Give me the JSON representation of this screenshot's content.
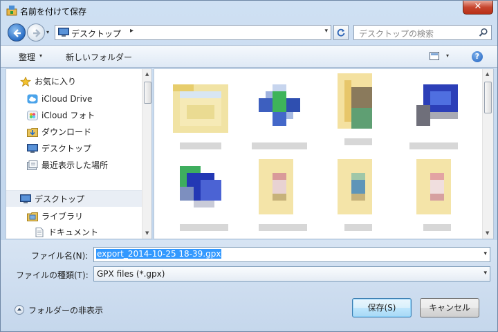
{
  "window": {
    "title": "名前を付けて保存",
    "close_glyph": "✕"
  },
  "address": {
    "location": "デスクトップ",
    "chevron": "▸",
    "dropdown": "▾"
  },
  "search": {
    "placeholder": "デスクトップの検索"
  },
  "toolbar": {
    "organize": "整理",
    "organize_arrow": "▾",
    "new_folder": "新しいフォルダー",
    "view_arrow": "▾",
    "help": "?"
  },
  "navpane": {
    "favorites": [
      {
        "label": "お気に入り",
        "icon": "star-icon"
      },
      {
        "label": "iCloud Drive",
        "icon": "icloud-icon"
      },
      {
        "label": "iCloud フォト",
        "icon": "photos-icon"
      },
      {
        "label": "ダウンロード",
        "icon": "download-folder-icon"
      },
      {
        "label": "デスクトップ",
        "icon": "desktop-icon"
      },
      {
        "label": "最近表示した場所",
        "icon": "recent-places-icon"
      }
    ],
    "tree": [
      {
        "label": "デスクトップ",
        "icon": "desktop-icon"
      },
      {
        "label": "ライブラリ",
        "icon": "library-icon"
      },
      {
        "label": "ドキュメント",
        "icon": "documents-icon"
      }
    ]
  },
  "form": {
    "filename_label": "ファイル名(N):",
    "filename_value": "export_2014-10-25 18-39.gpx",
    "filetype_label": "ファイルの種類(T):",
    "filetype_value": "GPX files (*.gpx)",
    "dropdown": "▾"
  },
  "footer": {
    "hide_folders": "フォルダーの非表示",
    "save": "保存(S)",
    "cancel": "キャンセル"
  },
  "colors": {
    "accent": "#3399ff",
    "window_bg": "#c9dbee",
    "close_red": "#c7452e"
  }
}
